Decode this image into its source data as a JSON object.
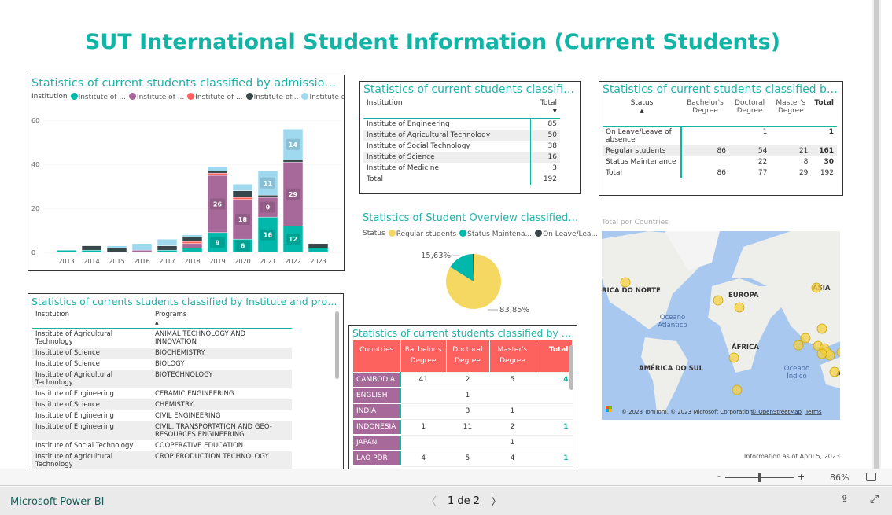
{
  "page_title": "SUT International Student Information (Current Students)",
  "colors": {
    "teal": "#01B8AA",
    "purple": "#A66999",
    "red": "#FD625E",
    "dark": "#374649",
    "lightblue": "#9ED9EF",
    "yellow": "#F5D862",
    "header_red": "#FD625E"
  },
  "year_chart": {
    "title": "Statistics of current students classified by admission year",
    "legend_label": "Institution",
    "legend": [
      "Institute of ...",
      "Institute of ...",
      "Institute of ...",
      "Institute of...",
      "Institute of..."
    ]
  },
  "chart_data": {
    "type": "bar",
    "stacked": true,
    "title": "Statistics of current students classified by admission year",
    "categories": [
      "2013",
      "2014",
      "2015",
      "2016",
      "2017",
      "2018",
      "2019",
      "2020",
      "2021",
      "2022",
      "2023"
    ],
    "ylim": [
      0,
      60
    ],
    "yticks": [
      0,
      20,
      40,
      60
    ],
    "grid": true,
    "legend_placement": "top-left",
    "series": [
      {
        "name": "Institute of ...",
        "color": "#01B8AA",
        "values": [
          1,
          1,
          0,
          0,
          1,
          2,
          9,
          6,
          16,
          12,
          2
        ]
      },
      {
        "name": "Institute of ...",
        "color": "#A66999",
        "values": [
          0,
          0,
          0,
          1,
          0,
          2,
          26,
          18,
          9,
          29,
          0
        ]
      },
      {
        "name": "Institute of ...",
        "color": "#FD625E",
        "values": [
          0,
          0,
          0,
          0,
          0,
          1,
          1,
          1,
          0,
          0,
          0
        ]
      },
      {
        "name": "Institute of...",
        "color": "#374649",
        "values": [
          0,
          2,
          2,
          0,
          2,
          2,
          1,
          3,
          1,
          1,
          2
        ]
      },
      {
        "name": "Institute of...",
        "color": "#9ED9EF",
        "values": [
          0,
          0,
          1,
          3,
          3,
          1,
          2,
          3,
          11,
          14,
          0
        ]
      }
    ],
    "data_labels_shown": {
      "2019": [
        9,
        26
      ],
      "2020": [
        6,
        18
      ],
      "2021": [
        16,
        9,
        11
      ],
      "2022": [
        12,
        29,
        14
      ]
    }
  },
  "faculty_table": {
    "title": "Statistics of current students classified by f...",
    "headers": [
      "Institution",
      "Total"
    ],
    "rows": [
      [
        "Institute of Engineering",
        "85"
      ],
      [
        "Institute of Agricultural Technology",
        "50"
      ],
      [
        "Institute of Social Technology",
        "38"
      ],
      [
        "Institute of Science",
        "16"
      ],
      [
        "Institute of Medicine",
        "3"
      ]
    ],
    "total": [
      "Total",
      "192"
    ]
  },
  "status_table": {
    "title": "Statistics of current students classified by Status",
    "headers": [
      "Status",
      "Bachelor's Degree",
      "Doctoral Degree",
      "Master's Degree",
      "Total"
    ],
    "rows": [
      [
        "On Leave/Leave of absence",
        "",
        "1",
        "",
        "1"
      ],
      [
        "Regular students",
        "86",
        "54",
        "21",
        "161"
      ],
      [
        "Status Maintenance",
        "",
        "22",
        "8",
        "30"
      ]
    ],
    "total": [
      "Total",
      "86",
      "77",
      "29",
      "192"
    ]
  },
  "pie": {
    "title": "Statistics of Student Overview classified by Status",
    "legend_label": "Status",
    "legend": [
      "Regular students",
      "Status Maintena...",
      "On Leave/Lea..."
    ],
    "slices": [
      {
        "name": "Regular students",
        "percent": 83.85,
        "color": "#F5D862"
      },
      {
        "name": "Status Maintenance",
        "percent": 15.63,
        "color": "#01B8AA"
      },
      {
        "name": "On Leave/Leave of absence",
        "percent": 0.52,
        "color": "#374649"
      }
    ],
    "label_regular": "83,85%",
    "label_maint": "15,63%"
  },
  "program_table": {
    "title": "Statistics of currents students classified by Institute and programs",
    "headers": [
      "Institution",
      "Programs"
    ],
    "rows": [
      [
        "Institute of Agricultural Technology",
        "ANIMAL TECHNOLOGY AND INNOVATION"
      ],
      [
        "Institute of Science",
        "BIOCHEMISTRY"
      ],
      [
        "Institute of Science",
        "BIOLOGY"
      ],
      [
        "Institute of Agricultural Technology",
        "BIOTECHNOLOGY"
      ],
      [
        "Institute of Engineering",
        "CERAMIC ENGINEERING"
      ],
      [
        "Institute of Science",
        "CHEMISTRY"
      ],
      [
        "Institute of Engineering",
        "CIVIL ENGINEERING"
      ],
      [
        "Institute of Engineering",
        "CIVIL, TRANSPORTATION AND GEO-RESOURCES ENGINEERING"
      ],
      [
        "Institute of Social Technology",
        "COOPERATIVE EDUCATION"
      ],
      [
        "Institute of Agricultural Technology",
        "CROP PRODUCTION TECHNOLOGY"
      ]
    ]
  },
  "country_table": {
    "title": "Statistics of  current students classified by  Coun...",
    "headers": [
      "Countries",
      "Bachelor's Degree",
      "Doctoral Degree",
      "Master's Degree",
      "Total"
    ],
    "rows": [
      [
        "CAMBODIA",
        "41",
        "2",
        "5",
        "4"
      ],
      [
        "ENGLISH",
        "",
        "1",
        "",
        ""
      ],
      [
        "INDIA",
        "",
        "3",
        "1",
        ""
      ],
      [
        "INDONESIA",
        "1",
        "11",
        "2",
        "1"
      ],
      [
        "JAPAN",
        "",
        "",
        "1",
        ""
      ],
      [
        "LAO PDR",
        "4",
        "5",
        "4",
        "1"
      ]
    ]
  },
  "map": {
    "title": "Total por Countries",
    "labels": [
      "RICA DO NORTE",
      "EUROPA",
      "ÁSIA",
      "Oceano Atlântico",
      "ÁFRICA",
      "AMÉRICA DO SUL",
      "Oceano Índico",
      "A"
    ],
    "attribution": "© 2023 TomTom, © 2023 Microsoft Corporation,",
    "osm_link": "© OpenStreetMap",
    "terms_link": "Terms"
  },
  "info_date": "Information as of  April 5,  2023",
  "zoom": {
    "level": "86%",
    "minus": "-",
    "plus": "+"
  },
  "footer": {
    "brand": "Microsoft Power BI",
    "page": "1 de 2"
  }
}
